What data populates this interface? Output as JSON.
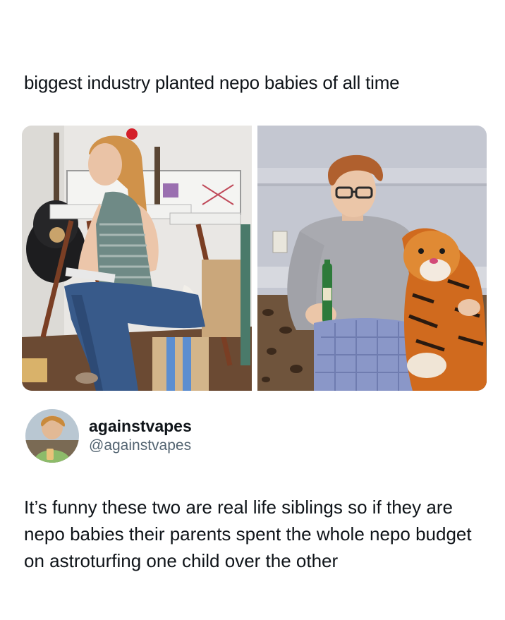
{
  "post": {
    "caption": "biggest industry planted nepo babies of all time",
    "images": [
      {
        "subject": "photo-young-woman-at-laptop-with-guitars"
      },
      {
        "subject": "photo-young-man-with-bottle-and-tiger-plush"
      }
    ]
  },
  "author": {
    "display_name": "againstvapes",
    "handle": "@againstvapes"
  },
  "reply": {
    "text": "It’s funny these two are real life siblings so if they are nepo babies their parents spent the whole nepo budget on astroturfing one child over the other"
  },
  "colors": {
    "text_primary": "#0f1419",
    "text_secondary": "#536471",
    "background": "#ffffff"
  }
}
